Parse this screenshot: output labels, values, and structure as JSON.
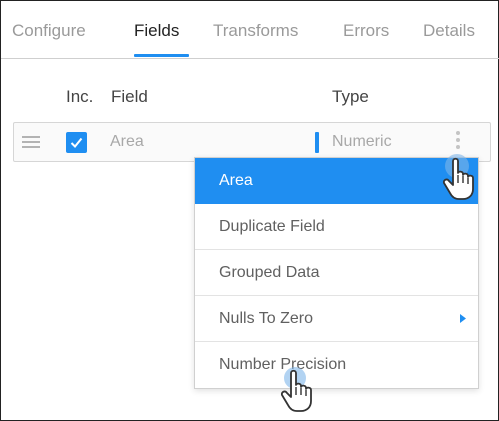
{
  "tabs": [
    {
      "label": "Configure",
      "active": false
    },
    {
      "label": "Fields",
      "active": true
    },
    {
      "label": "Transforms",
      "active": false
    },
    {
      "label": "Errors",
      "active": false
    },
    {
      "label": "Details",
      "active": false
    }
  ],
  "table": {
    "headers": {
      "inc": "Inc.",
      "field": "Field",
      "type": "Type"
    },
    "rows": [
      {
        "included": true,
        "field": "Area",
        "type": "Numeric"
      }
    ]
  },
  "menu": {
    "items": [
      {
        "label": "Area",
        "selected": true,
        "submenu": false
      },
      {
        "label": "Duplicate Field",
        "selected": false,
        "submenu": false
      },
      {
        "label": "Grouped Data",
        "selected": false,
        "submenu": false
      },
      {
        "label": "Nulls To Zero",
        "selected": false,
        "submenu": true
      },
      {
        "label": "Number Precision",
        "selected": false,
        "submenu": false
      }
    ]
  },
  "icons": {
    "drag_handle": "drag-handle-icon",
    "checkbox": "check-icon",
    "kebab": "kebab-menu-icon",
    "submenu_arrow": "chevron-right-icon",
    "pointer": "hand-pointer-icon"
  },
  "colors": {
    "accent": "#1f8ef1",
    "active_text": "#222222",
    "inactive_text": "#9a9a9a"
  }
}
